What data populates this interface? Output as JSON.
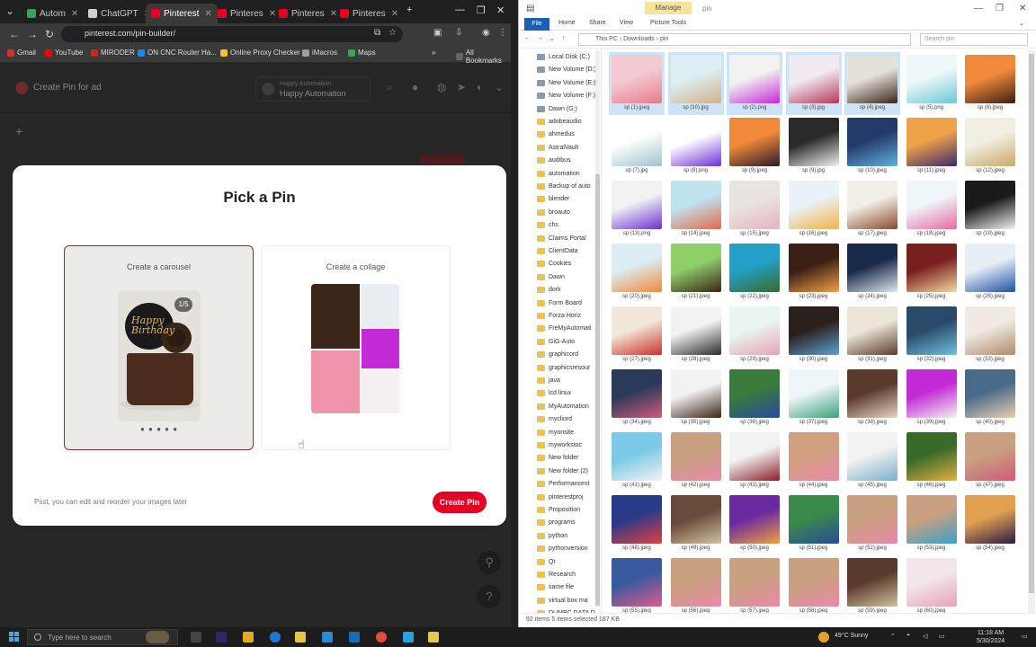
{
  "browser": {
    "tabs": [
      {
        "label": "Autom",
        "color": "#3aa05b",
        "active": false
      },
      {
        "label": "ChatGPT",
        "color": "#cfcfcf",
        "active": false
      },
      {
        "label": "Pinterest",
        "color": "#e60023",
        "active": true
      },
      {
        "label": "Pinteres",
        "color": "#e60023",
        "active": false
      },
      {
        "label": "Pinteres",
        "color": "#e60023",
        "active": false
      },
      {
        "label": "Pinteres",
        "color": "#e60023",
        "active": false
      }
    ],
    "url": "pinterest.com/pin-builder/",
    "bookmarks": [
      {
        "label": "Gmail",
        "color": "#d93025"
      },
      {
        "label": "YouTube",
        "color": "#ff0000"
      },
      {
        "label": "MIRODER",
        "color": "#c62828"
      },
      {
        "label": "ON CNC Router Ha...",
        "color": "#1e88e5"
      },
      {
        "label": "Online Proxy Checker",
        "color": "#fbc02d"
      },
      {
        "label": "iMacros",
        "color": "#9e9e9e"
      },
      {
        "label": "Maps",
        "color": "#34a853"
      }
    ],
    "all_bookmarks": "All Bookmarks"
  },
  "pinterest": {
    "header_title": "Create Pin for ad",
    "account_line1": "Happy Automation",
    "account_line2": "Happy Automation"
  },
  "modal": {
    "title": "Pick a Pin",
    "option1_label": "Create a carousel",
    "option2_label": "Create a collage",
    "carousel_count": "1/5",
    "cake_text": "Happy Birthday",
    "dots": "● ● ● ● ●",
    "note": "Psst, you can edit and reorder your images later",
    "create_button": "Create Pin"
  },
  "explorer": {
    "manage_tab": "Manage",
    "title_path": "pin",
    "ribbon_tabs": [
      "File",
      "Home",
      "Share",
      "View",
      "Picture Tools"
    ],
    "address": "This PC  ›  Downloads  ›  pin",
    "search_placeholder": "Search pin",
    "nav_items": [
      {
        "label": "Local Disk (C:)",
        "kind": "drive"
      },
      {
        "label": "New Volume (D:)",
        "kind": "drive"
      },
      {
        "label": "New Volume (E:)",
        "kind": "drive"
      },
      {
        "label": "New Volume (F:)",
        "kind": "drive"
      },
      {
        "label": "Dawn (G:)",
        "kind": "drive"
      },
      {
        "label": "adobeaudio",
        "kind": "folder"
      },
      {
        "label": "ahmedus",
        "kind": "folder"
      },
      {
        "label": "AstralVault",
        "kind": "folder"
      },
      {
        "label": "audibus",
        "kind": "folder"
      },
      {
        "label": "automation",
        "kind": "folder"
      },
      {
        "label": "Backup of auto",
        "kind": "folder"
      },
      {
        "label": "blender",
        "kind": "folder"
      },
      {
        "label": "broauto",
        "kind": "folder"
      },
      {
        "label": "chs",
        "kind": "folder"
      },
      {
        "label": "Claims Portal",
        "kind": "folder"
      },
      {
        "label": "ClientData",
        "kind": "folder"
      },
      {
        "label": "Cookies",
        "kind": "folder"
      },
      {
        "label": "Dawn",
        "kind": "folder"
      },
      {
        "label": "dork",
        "kind": "folder"
      },
      {
        "label": "Form Board",
        "kind": "folder"
      },
      {
        "label": "Forza Horiz",
        "kind": "folder"
      },
      {
        "label": "FreMyAutomati",
        "kind": "folder"
      },
      {
        "label": "GiG-Auto",
        "kind": "folder"
      },
      {
        "label": "graphicord",
        "kind": "folder"
      },
      {
        "label": "graphicsresour",
        "kind": "folder"
      },
      {
        "label": "java",
        "kind": "folder"
      },
      {
        "label": "lcd linux",
        "kind": "folder"
      },
      {
        "label": "MyAutomation",
        "kind": "folder"
      },
      {
        "label": "mycliord",
        "kind": "folder"
      },
      {
        "label": "myonsite",
        "kind": "folder"
      },
      {
        "label": "myworkstoc",
        "kind": "folder"
      },
      {
        "label": "New folder",
        "kind": "folder"
      },
      {
        "label": "New folder (2)",
        "kind": "folder"
      },
      {
        "label": "Performancest",
        "kind": "folder"
      },
      {
        "label": "pinterestproj",
        "kind": "folder"
      },
      {
        "label": "Proposition",
        "kind": "folder"
      },
      {
        "label": "programs",
        "kind": "folder"
      },
      {
        "label": "python",
        "kind": "folder"
      },
      {
        "label": "pythonversion",
        "kind": "folder"
      },
      {
        "label": "Qt",
        "kind": "folder"
      },
      {
        "label": "Research",
        "kind": "folder"
      },
      {
        "label": "same file",
        "kind": "folder"
      },
      {
        "label": "virtual box ma",
        "kind": "folder"
      },
      {
        "label": "DUMBC DATA D",
        "kind": "folder"
      }
    ],
    "files": [
      {
        "name": "sp (1).jpeg",
        "c1": "#f4c9d2",
        "c2": "#e57a8a",
        "sel": true
      },
      {
        "name": "sp (10).jpg",
        "c1": "#dfeef2",
        "c2": "#cfb28f",
        "sel": true
      },
      {
        "name": "sp (2).png",
        "c1": "#f2f2f2",
        "c2": "#c42ad6",
        "sel": true
      },
      {
        "name": "sp (3).jpg",
        "c1": "#f1eaf2",
        "c2": "#b23a5a",
        "sel": true
      },
      {
        "name": "sp (4).jpeg",
        "c1": "#e4e1da",
        "c2": "#3b2418",
        "sel": true
      },
      {
        "name": "sp (5).png",
        "c1": "#eef7f9",
        "c2": "#67c9d4",
        "sel": false
      },
      {
        "name": "sp (6).jpeg",
        "c1": "#f08a3a",
        "c2": "#3a1f14",
        "sel": false
      },
      {
        "name": "sp (7).jpg",
        "c1": "#ffffff",
        "c2": "#9fc3cf",
        "sel": false
      },
      {
        "name": "sp (8).png",
        "c1": "#ffffff",
        "c2": "#6b2fd6",
        "sel": false
      },
      {
        "name": "sp (9).jpeg",
        "c1": "#f08a3a",
        "c2": "#2a1a2a",
        "sel": false
      },
      {
        "name": "sp (9).jpg",
        "c1": "#2a2a2a",
        "c2": "#f2f2f2",
        "sel": false
      },
      {
        "name": "sp (10).jpeg",
        "c1": "#243b6a",
        "c2": "#5fb0e0",
        "sel": false
      },
      {
        "name": "sp (11).jpeg",
        "c1": "#f0a24a",
        "c2": "#3a2a6a",
        "sel": false
      },
      {
        "name": "sp (12).jpeg",
        "c1": "#f2efe2",
        "c2": "#c9a86a",
        "sel": false
      },
      {
        "name": "sp (13).png",
        "c1": "#f2f2f2",
        "c2": "#6b2fd6",
        "sel": false
      },
      {
        "name": "sp (14).jpeg",
        "c1": "#bfe3ef",
        "c2": "#e26a4a",
        "sel": false
      },
      {
        "name": "sp (15).jpeg",
        "c1": "#e9e4df",
        "c2": "#e7b3c0",
        "sel": false
      },
      {
        "name": "sp (16).jpeg",
        "c1": "#e9f2f6",
        "c2": "#f2b24a",
        "sel": false
      },
      {
        "name": "sp (17).jpeg",
        "c1": "#f2efe8",
        "c2": "#8a4a2a",
        "sel": false
      },
      {
        "name": "sp (18).jpeg",
        "c1": "#eef6fa",
        "c2": "#e96aa0",
        "sel": false
      },
      {
        "name": "sp (19).jpeg",
        "c1": "#1a1a1a",
        "c2": "#f2f2f2",
        "sel": false
      },
      {
        "name": "sp (20).jpeg",
        "c1": "#dcecf4",
        "c2": "#f08a3a",
        "sel": false
      },
      {
        "name": "sp (21).jpeg",
        "c1": "#8fcf6a",
        "c2": "#3a2418",
        "sel": false
      },
      {
        "name": "sp (22).jpeg",
        "c1": "#23a0c9",
        "c2": "#3a6a2a",
        "sel": false
      },
      {
        "name": "sp (23).jpeg",
        "c1": "#3a1f14",
        "c2": "#f0a04a",
        "sel": false
      },
      {
        "name": "sp (24).jpeg",
        "c1": "#1a2a4a",
        "c2": "#e0e6ee",
        "sel": false
      },
      {
        "name": "sp (25).jpeg",
        "c1": "#7a1f1f",
        "c2": "#f2d9a0",
        "sel": false
      },
      {
        "name": "sp (26).jpeg",
        "c1": "#e6eef6",
        "c2": "#1f4fa0",
        "sel": false
      },
      {
        "name": "sp (27).jpeg",
        "c1": "#f2e8da",
        "c2": "#c9302a",
        "sel": false
      },
      {
        "name": "sp (28).jpeg",
        "c1": "#f2f2f2",
        "c2": "#2a2a2a",
        "sel": false
      },
      {
        "name": "sp (29).jpeg",
        "c1": "#e9f6f0",
        "c2": "#e7a3b3",
        "sel": false
      },
      {
        "name": "sp (30).jpeg",
        "c1": "#2a1f1a",
        "c2": "#5fa0d6",
        "sel": false
      },
      {
        "name": "sp (31).jpeg",
        "c1": "#ece6da",
        "c2": "#5a3a2a",
        "sel": false
      },
      {
        "name": "sp (32).jpeg",
        "c1": "#2a4a6a",
        "c2": "#6fc0e0",
        "sel": false
      },
      {
        "name": "sp (33).jpeg",
        "c1": "#f0eae2",
        "c2": "#b08a6a",
        "sel": false
      },
      {
        "name": "sp (34).jpeg",
        "c1": "#2a3a5a",
        "c2": "#d05a7a",
        "sel": false
      },
      {
        "name": "sp (35).jpeg",
        "c1": "#f2f2f2",
        "c2": "#3a2418",
        "sel": false
      },
      {
        "name": "sp (36).jpeg",
        "c1": "#3a7a3a",
        "c2": "#2a4aa0",
        "sel": false
      },
      {
        "name": "sp (37).jpeg",
        "c1": "#eef6fa",
        "c2": "#3aa07a",
        "sel": false
      },
      {
        "name": "sp (38).jpeg",
        "c1": "#5a3a2a",
        "c2": "#e6d6c6",
        "sel": false
      },
      {
        "name": "sp (39).jpeg",
        "c1": "#c42ad6",
        "c2": "#f2f2f2",
        "sel": false
      },
      {
        "name": "sp (40).jpeg",
        "c1": "#4a6a8a",
        "c2": "#e6d0b0",
        "sel": false
      },
      {
        "name": "sp (41).jpeg",
        "c1": "#7ac9e6",
        "c2": "#f2f2f2",
        "sel": false
      },
      {
        "name": "sp (42).jpeg",
        "c1": "#c9a080",
        "c2": "#e98aa8",
        "sel": false
      },
      {
        "name": "sp (43).jpeg",
        "c1": "#f2f2f2",
        "c2": "#8a1f2a",
        "sel": false
      },
      {
        "name": "sp (44).jpeg",
        "c1": "#d0a080",
        "c2": "#e98aa8",
        "sel": false
      },
      {
        "name": "sp (45).jpeg",
        "c1": "#f2f2f2",
        "c2": "#7ab0c9",
        "sel": false
      },
      {
        "name": "sp (46).jpeg",
        "c1": "#3a6a2a",
        "c2": "#e0b040",
        "sel": false
      },
      {
        "name": "sp (47).jpeg",
        "c1": "#c9a080",
        "c2": "#d05a7a",
        "sel": false
      },
      {
        "name": "sp (48).jpeg",
        "c1": "#2a3a8a",
        "c2": "#e04040",
        "sel": false
      },
      {
        "name": "sp (49).jpeg",
        "c1": "#6a4a3a",
        "c2": "#d0c0a0",
        "sel": false
      },
      {
        "name": "sp (50).jpeg",
        "c1": "#6a2aa0",
        "c2": "#f0a040",
        "sel": false
      },
      {
        "name": "sp (51).jpeg",
        "c1": "#3a8a4a",
        "c2": "#2a4a9a",
        "sel": false
      },
      {
        "name": "sp (52).jpeg",
        "c1": "#c9a080",
        "c2": "#e98aa8",
        "sel": false
      },
      {
        "name": "sp (53).jpeg",
        "c1": "#c9a080",
        "c2": "#3aa0c9",
        "sel": false
      },
      {
        "name": "sp (54).jpeg",
        "c1": "#e0a050",
        "c2": "#2a1a4a",
        "sel": false
      },
      {
        "name": "sp (55).jpeg",
        "c1": "#3a5aa0",
        "c2": "#e05a8a",
        "sel": false
      },
      {
        "name": "sp (56).jpeg",
        "c1": "#c9a080",
        "c2": "#e98aa8",
        "sel": false
      },
      {
        "name": "sp (57).jpeg",
        "c1": "#c9a080",
        "c2": "#e98aa8",
        "sel": false
      },
      {
        "name": "sp (58).jpeg",
        "c1": "#c9a080",
        "c2": "#e98aa8",
        "sel": false
      },
      {
        "name": "sp (59).jpeg",
        "c1": "#5a3a2a",
        "c2": "#d0c0a0",
        "sel": false
      },
      {
        "name": "sp (60).jpeg",
        "c1": "#f2e6ea",
        "c2": "#e7a3b3",
        "sel": false
      }
    ],
    "status": "92 items     5 items selected  187 KB"
  },
  "taskbar": {
    "search_placeholder": "Type here to search",
    "weather": "49°C  Sunny",
    "time": "11:18 AM",
    "date": "5/30/2024"
  }
}
